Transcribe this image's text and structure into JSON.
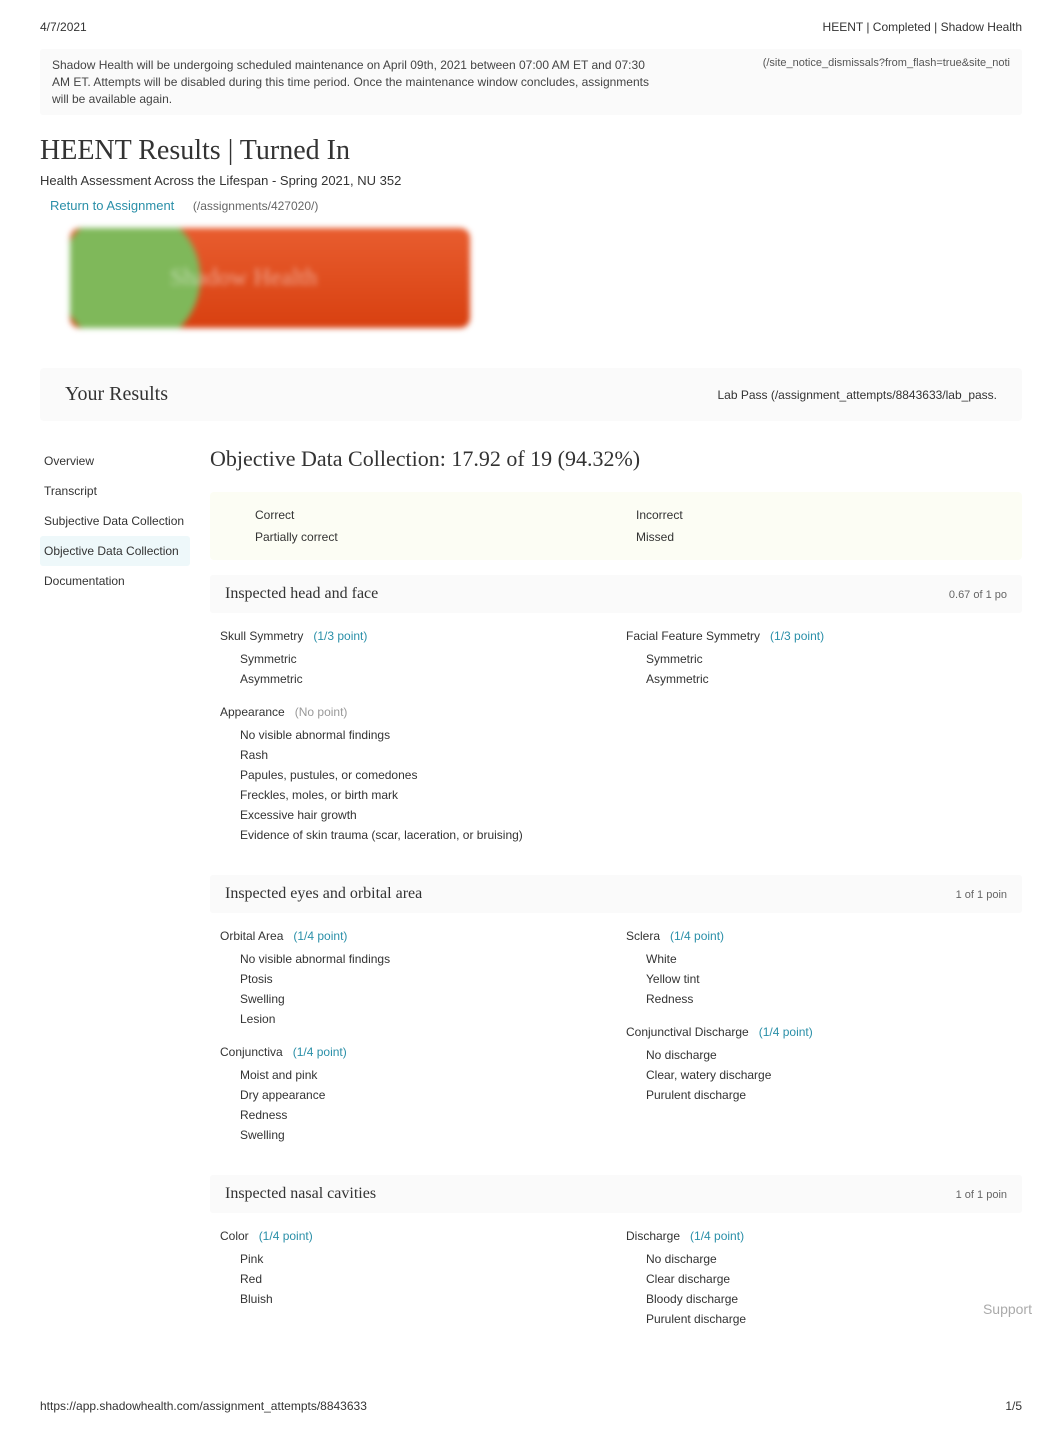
{
  "meta": {
    "date": "4/7/2021",
    "breadcrumb": "HEENT | Completed | Shadow Health",
    "url": "https://app.shadowhealth.com/assignment_attempts/8843633",
    "page_num": "1/5"
  },
  "notice": {
    "text": "Shadow Health will be undergoing scheduled maintenance on April 09th, 2021 between 07:00 AM ET and 07:30 AM ET. Attempts will be disabled during this time period. Once the maintenance window concludes, assignments will be available again.",
    "dismiss": "(/site_notice_dismissals?from_flash=true&site_noti"
  },
  "header": {
    "title": "HEENT Results | Turned In",
    "subtitle": "Health Assessment Across the Lifespan - Spring 2021, NU 352",
    "return_label": "Return to Assignment",
    "return_path": "(/assignments/427020/)"
  },
  "banner": {
    "text": "Shadow Health"
  },
  "results": {
    "title": "Your Results",
    "lab_pass": "Lab Pass (/assignment_attempts/8843633/lab_pass."
  },
  "sidebar": {
    "items": [
      {
        "label": "Overview"
      },
      {
        "label": "Transcript"
      },
      {
        "label": "Subjective Data Collection"
      },
      {
        "label": "Objective Data Collection"
      },
      {
        "label": "Documentation"
      }
    ]
  },
  "score": {
    "title": "Objective Data Collection: 17.92 of 19 (94.32%)"
  },
  "legend": {
    "correct": "Correct",
    "partially": "Partially correct",
    "incorrect": "Incorrect",
    "missed": "Missed"
  },
  "sections": [
    {
      "title": "Inspected head and face",
      "points": "0.67 of 1 po",
      "left": [
        {
          "label": "Skull Symmetry",
          "pts": "(1/3 point)",
          "pts_class": "blue",
          "options": [
            "Symmetric",
            "Asymmetric"
          ]
        },
        {
          "label": "Appearance",
          "pts": "(No point)",
          "pts_class": "gray",
          "options": [
            "No visible abnormal findings",
            "Rash",
            "Papules, pustules, or comedones",
            "Freckles, moles, or birth mark",
            "Excessive hair growth",
            "Evidence of skin trauma (scar, laceration, or bruising)"
          ]
        }
      ],
      "right": [
        {
          "label": "Facial Feature Symmetry",
          "pts": "(1/3 point)",
          "pts_class": "blue",
          "options": [
            "Symmetric",
            "Asymmetric"
          ]
        }
      ]
    },
    {
      "title": "Inspected eyes and orbital area",
      "points": "1 of 1 poin",
      "left": [
        {
          "label": "Orbital Area",
          "pts": "(1/4 point)",
          "pts_class": "blue",
          "options": [
            "No visible abnormal findings",
            "Ptosis",
            "Swelling",
            "Lesion"
          ]
        },
        {
          "label": "Conjunctiva",
          "pts": "(1/4 point)",
          "pts_class": "blue",
          "options": [
            "Moist and pink",
            "Dry appearance",
            "Redness",
            "Swelling"
          ]
        }
      ],
      "right": [
        {
          "label": "Sclera",
          "pts": "(1/4 point)",
          "pts_class": "blue",
          "options": [
            "White",
            "Yellow tint",
            "Redness"
          ]
        },
        {
          "label": "Conjunctival Discharge",
          "pts": "(1/4 point)",
          "pts_class": "blue",
          "options": [
            "No discharge",
            "Clear, watery discharge",
            "Purulent discharge"
          ]
        }
      ]
    },
    {
      "title": "Inspected nasal cavities",
      "points": "1 of 1 poin",
      "left": [
        {
          "label": "Color",
          "pts": "(1/4 point)",
          "pts_class": "blue",
          "options": [
            "Pink",
            "Red",
            "Bluish"
          ]
        }
      ],
      "right": [
        {
          "label": "Discharge",
          "pts": "(1/4 point)",
          "pts_class": "blue",
          "options": [
            "No discharge",
            "Clear discharge",
            "Bloody discharge",
            "Purulent discharge"
          ]
        }
      ]
    }
  ],
  "support": "Support"
}
